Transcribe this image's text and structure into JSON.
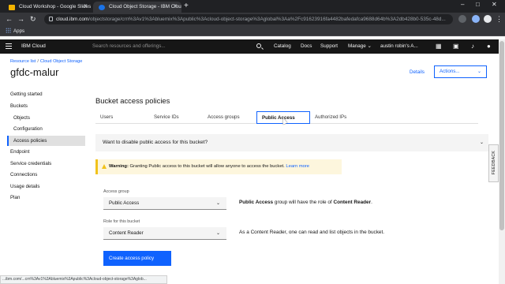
{
  "browser": {
    "tabs": [
      {
        "title": "Cloud Workshop - Google Slides",
        "favicon_color": "#f4b400"
      },
      {
        "title": "Cloud Object Storage - IBM Clou",
        "favicon_color": "#1a73e8"
      }
    ],
    "url_host": "cloud.ibm.com",
    "url_path": "/objectstorage/crn%3Av1%3Abluemix%3Apublic%3Acloud-object-storage%3Aglobal%3Aa%2Fc91623916fa4482bafedafca9688d64b%3A2db428b0-535c-48d...",
    "bookmarks_apps": "Apps",
    "status_url": "...ibm.com/...crn%3Av1%3Abluemix%3Apublic%3Acloud-object-storage%3Aglob..."
  },
  "header": {
    "brand": "IBM Cloud",
    "search_placeholder": "Search resources and offerings...",
    "nav": [
      "Catalog",
      "Docs",
      "Support",
      "Manage"
    ],
    "account": "austin robin's A..."
  },
  "breadcrumb": [
    "Resource list",
    "Cloud Object Storage"
  ],
  "page_title": "gfdc-malur",
  "details_link": "Details",
  "actions_label": "Actions...",
  "sidebar": {
    "items": [
      {
        "label": "Getting started"
      },
      {
        "label": "Buckets"
      },
      {
        "label": "Objects"
      },
      {
        "label": "Configuration"
      },
      {
        "label": "Access policies"
      },
      {
        "label": "Endpoint"
      },
      {
        "label": "Service credentials"
      },
      {
        "label": "Connections"
      },
      {
        "label": "Usage details"
      },
      {
        "label": "Plan"
      }
    ],
    "active": "Access policies"
  },
  "section_title": "Bucket access policies",
  "tabs": [
    "Users",
    "Service IDs",
    "Access groups",
    "Public Access",
    "Authorized IPs"
  ],
  "selected_tab": "Public Access",
  "accordion": "Want to disable public access for this bucket?",
  "warning": {
    "bold": "Warning:",
    "text": "Granting Public access to this bucket will allow anyone to access the bucket.",
    "link": "Learn more"
  },
  "form": {
    "access_group_label": "Access group",
    "access_group_value": "Public Access",
    "role_label": "Role for this bucket",
    "role_value": "Content Reader",
    "group_desc_bold1": "Public Access",
    "group_desc_mid": " group will have the role of ",
    "group_desc_bold2": "Content Reader",
    "group_desc_end": ".",
    "role_desc": "As a Content Reader, one can read and list objects in the bucket.",
    "submit": "Create access policy"
  },
  "feedback": "FEEDBACK",
  "colors": {
    "accent": "#0f62fe",
    "warning": "#f1c21b",
    "header": "#161616"
  }
}
